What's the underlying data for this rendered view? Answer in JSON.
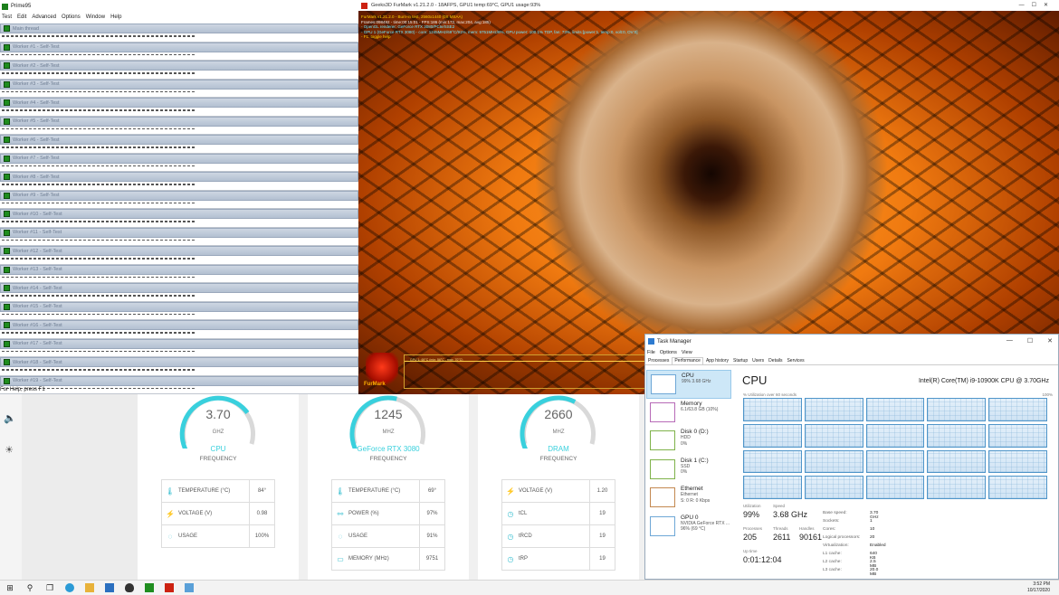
{
  "prime95": {
    "title": "Prime95",
    "menu": [
      "Test",
      "Edit",
      "Advanced",
      "Options",
      "Window",
      "Help"
    ],
    "main_thread": "Main thread",
    "workers": [
      "Worker #1 - Self-Test",
      "Worker #2 - Self-Test",
      "Worker #3 - Self-Test",
      "Worker #4 - Self-Test",
      "Worker #5 - Self-Test",
      "Worker #6 - Self-Test",
      "Worker #7 - Self-Test",
      "Worker #8 - Self-Test",
      "Worker #9 - Self-Test",
      "Worker #10 - Self-Test",
      "Worker #11 - Self-Test",
      "Worker #12 - Self-Test",
      "Worker #13 - Self-Test",
      "Worker #14 - Self-Test",
      "Worker #15 - Self-Test",
      "Worker #16 - Self-Test",
      "Worker #17 - Self-Test",
      "Worker #18 - Self-Test",
      "Worker #19 - Self-Test"
    ],
    "status": "For Help, press F1"
  },
  "monitor": {
    "gauges": [
      {
        "value": "3.70",
        "unit": "GHZ",
        "name": "CPU",
        "sub": "FREQUENCY",
        "level": 0.7
      },
      {
        "value": "1245",
        "unit": "MHZ",
        "name": "GeForce RTX 3080",
        "sub": "FREQUENCY",
        "level": 0.55
      },
      {
        "value": "2660",
        "unit": "MHZ",
        "name": "DRAM",
        "sub": "FREQUENCY",
        "level": 0.6
      }
    ],
    "tables": [
      [
        {
          "icon": "thermometer-icon",
          "label": "TEMPERATURE (°C)",
          "value": "84°"
        },
        {
          "icon": "bolt-icon",
          "label": "VOLTAGE (V)",
          "value": "0.98"
        },
        {
          "icon": "gauge-icon",
          "label": "USAGE",
          "value": "100%"
        }
      ],
      [
        {
          "icon": "thermometer-icon",
          "label": "TEMPERATURE (°C)",
          "value": "69°"
        },
        {
          "icon": "plug-icon",
          "label": "POWER (%)",
          "value": "97%"
        },
        {
          "icon": "gauge-icon",
          "label": "USAGE",
          "value": "91%"
        },
        {
          "icon": "memory-icon",
          "label": "MEMORY (MHz)",
          "value": "9751"
        }
      ],
      [
        {
          "icon": "bolt-icon",
          "label": "VOLTAGE (V)",
          "value": "1.20"
        },
        {
          "icon": "timing-icon",
          "label": "tCL",
          "value": "19"
        },
        {
          "icon": "timing-icon",
          "label": "tRCD",
          "value": "19"
        },
        {
          "icon": "timing-icon",
          "label": "tRP",
          "value": "19"
        }
      ]
    ]
  },
  "furmark": {
    "title": "Geeks3D FurMark v1.21.2.0 - 18AFPS, GPU1 temp:69°C, GPU1 usage:93%",
    "overlay": [
      "FurMark v1.21.2.0 - Burn-in test, 2560x1440 (0X MSAA)",
      "Frames:098492 - time:00:15:01 - FPS:186 (min:172, max:204, avg:185)",
      "- OpenGL renderer: GeForce RTX 3080/PCIe/SSE2",
      "- GPU 1 (GeForce RTX 3080) - core: 1245MHz/69°C/91%, mem: 9751MHz/6%, GPU power: 100.1% TDP, fan: 73%, limits:[power:1, temp:0, volt:0, OV:0]",
      "- F1: toggle help"
    ],
    "graph_label": "GPU 1: 69°C (min: 56°C - max: 70°C)",
    "logo": "FurMark"
  },
  "taskmanager": {
    "title": "Task Manager",
    "menu": [
      "File",
      "Options",
      "View"
    ],
    "tabs": [
      "Processes",
      "Performance",
      "App history",
      "Startup",
      "Users",
      "Details",
      "Services"
    ],
    "sidebar": [
      {
        "name": "CPU",
        "l1": "99%  3.68 GHz",
        "l2": "",
        "l3": ""
      },
      {
        "name": "Memory",
        "l1": "6.1/63.8 GB (10%)",
        "l2": "",
        "l3": ""
      },
      {
        "name": "Disk 0 (D:)",
        "l1": "HDD",
        "l2": "0%",
        "l3": ""
      },
      {
        "name": "Disk 1 (C:)",
        "l1": "SSD",
        "l2": "0%",
        "l3": ""
      },
      {
        "name": "Ethernet",
        "l1": "Ethernet",
        "l2": "S: 0  R: 0 Kbps",
        "l3": ""
      },
      {
        "name": "GPU 0",
        "l1": "NVIDIA GeForce RTX ...",
        "l2": "96%  (69 °C)",
        "l3": ""
      }
    ],
    "heading": "CPU",
    "model": "Intel(R) Core(TM) i9-10900K CPU @ 3.70GHz",
    "util_label": "% Utilization over 60 seconds",
    "util_max": "100%",
    "stats": {
      "utilization_label": "Utilization",
      "utilization": "99%",
      "speed_label": "Speed",
      "speed": "3.68 GHz",
      "processes_label": "Processes",
      "processes": "205",
      "threads_label": "Threads",
      "threads": "2611",
      "handles_label": "Handles",
      "handles": "90161",
      "uptime_label": "Up time",
      "uptime": "0:01:12:04"
    },
    "specs": [
      {
        "k": "Base speed:",
        "v": "3.70 GHz"
      },
      {
        "k": "Sockets:",
        "v": "1"
      },
      {
        "k": "Cores:",
        "v": "10"
      },
      {
        "k": "Logical processors:",
        "v": "20"
      },
      {
        "k": "Virtualization:",
        "v": "Enabled"
      },
      {
        "k": "L1 cache:",
        "v": "640 KB"
      },
      {
        "k": "L2 cache:",
        "v": "2.5 MB"
      },
      {
        "k": "L3 cache:",
        "v": "20.0 MB"
      }
    ]
  },
  "taskbar": {
    "time": "3:52 PM",
    "date": "10/17/2020",
    "items": [
      "start-icon",
      "search-icon",
      "task-view-icon",
      "edge-icon",
      "file-explorer-icon",
      "mail-icon",
      "alienware-icon",
      "prime95-icon",
      "furmark-icon",
      "task-manager-icon"
    ]
  },
  "colors": {
    "accent": "#39d0dd",
    "taskman_blue": "#4f95c9"
  }
}
